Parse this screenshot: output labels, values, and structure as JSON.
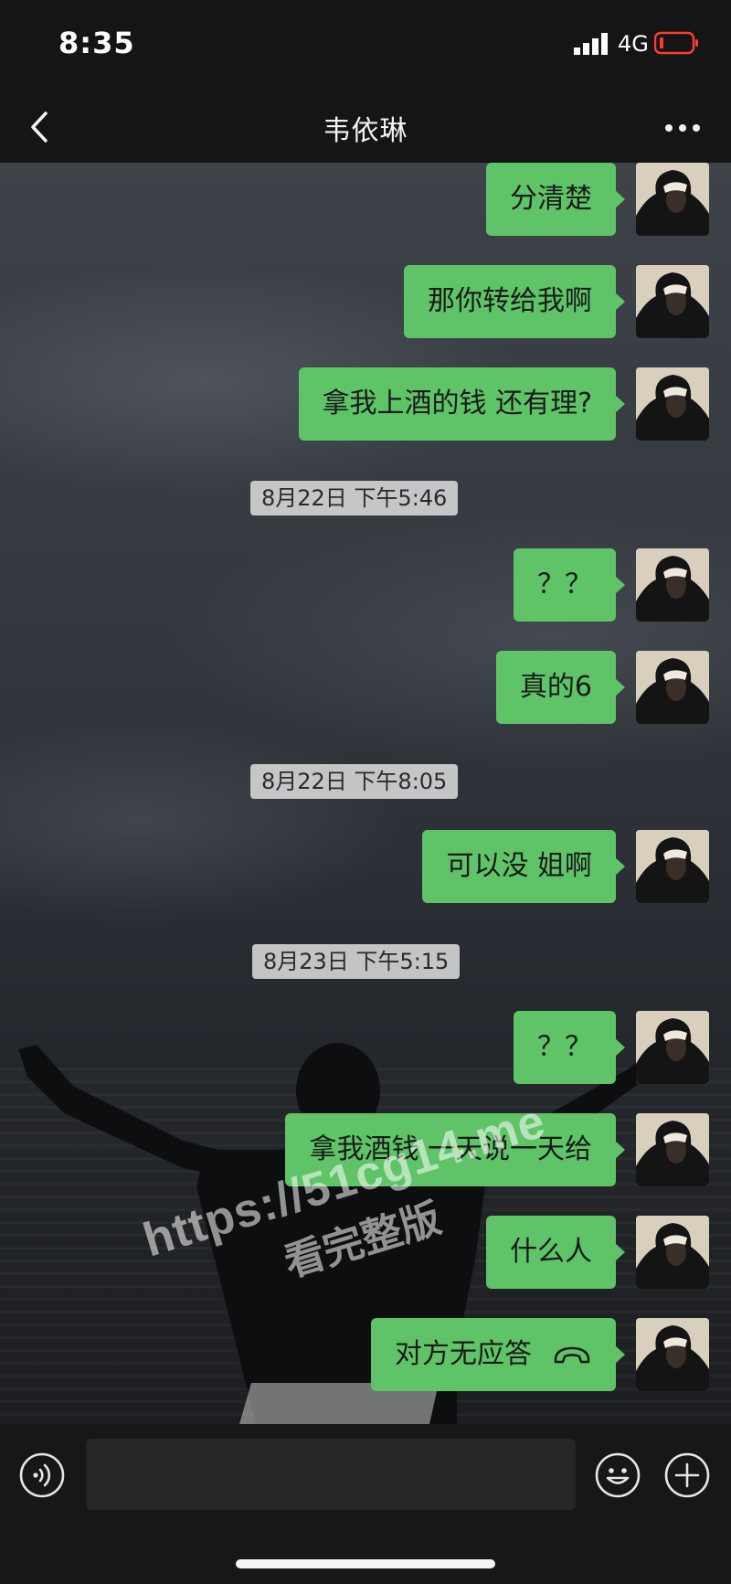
{
  "status_bar": {
    "time": "8:35",
    "network": "4G",
    "signal_icon": "signal-bars-icon",
    "battery_icon": "battery-low-icon",
    "battery_color": "#ff3b30"
  },
  "nav": {
    "title": "韦依琳",
    "back_icon": "chevron-left-icon",
    "more_icon": "more-dots-icon"
  },
  "messages": [
    {
      "text": "分清楚"
    },
    {
      "text": "那你转给我啊"
    },
    {
      "text": "拿我上酒的钱 还有理?"
    },
    {
      "timestamp": "8月22日 下午5:46"
    },
    {
      "text": "？？"
    },
    {
      "text": "真的6"
    },
    {
      "timestamp": "8月22日 下午8:05"
    },
    {
      "text": "可以没 姐啊"
    },
    {
      "timestamp": "8月23日 下午5:15"
    },
    {
      "text": "？？"
    },
    {
      "text": "拿我酒钱 一天说一天给"
    },
    {
      "text": "什么人"
    },
    {
      "text": "对方无应答",
      "icon": "phone-hangup-icon"
    }
  ],
  "watermark": {
    "url": "https://51cg14.me",
    "note": "看完整版"
  },
  "input_bar": {
    "voice_icon": "voice-icon",
    "emoji_icon": "emoji-icon",
    "plus_icon": "plus-icon",
    "input_value": ""
  },
  "colors": {
    "bubble": "#5fc468",
    "timestamp_bg": "#dadada",
    "bar_bg": "#151515"
  }
}
